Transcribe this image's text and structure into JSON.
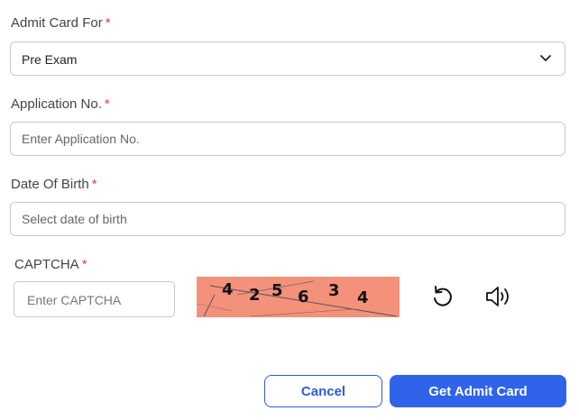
{
  "form": {
    "admit_card_for": {
      "label": "Admit Card For",
      "required_mark": "*",
      "selected": "Pre Exam"
    },
    "application_no": {
      "label": "Application No.",
      "required_mark": "*",
      "placeholder": "Enter Application No."
    },
    "dob": {
      "label": "Date Of Birth",
      "required_mark": "*",
      "placeholder": "Select date of birth"
    },
    "captcha": {
      "label": "CAPTCHA",
      "required_mark": "*",
      "placeholder": "Enter CAPTCHA",
      "digits": [
        "4",
        "2",
        "5",
        "6",
        "3",
        "4"
      ],
      "background_color": "#f4917a",
      "refresh_icon": "refresh-icon",
      "audio_icon": "speaker-icon"
    }
  },
  "buttons": {
    "cancel": "Cancel",
    "submit": "Get Admit Card"
  },
  "colors": {
    "primary": "#2f63ea",
    "required": "#e0453a",
    "border": "#c9c9c9"
  }
}
